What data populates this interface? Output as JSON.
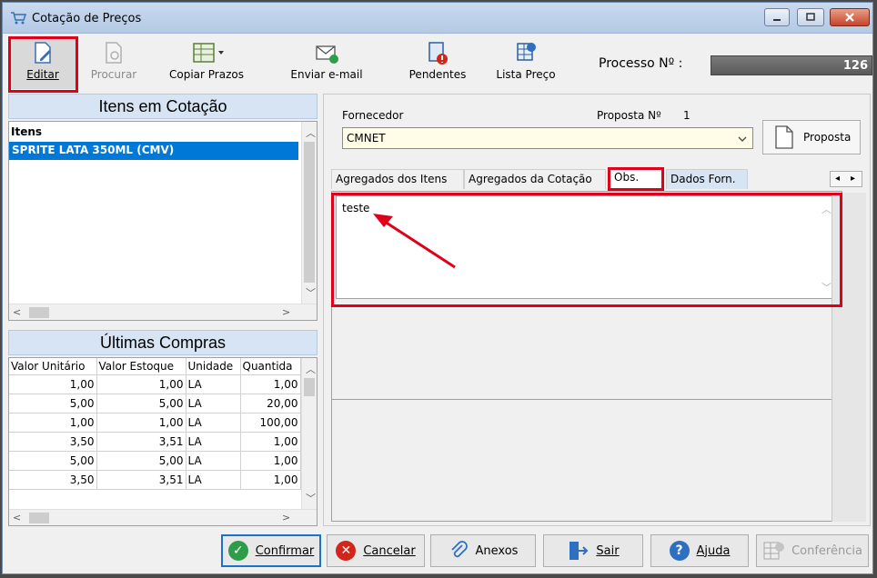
{
  "window": {
    "title": "Cotação de Preços"
  },
  "toolbar": {
    "editar": "Editar",
    "procurar": "Procurar",
    "copiar_prazos": "Copiar Prazos",
    "enviar_email": "Enviar e-mail",
    "pendentes": "Pendentes",
    "lista_preco": "Lista Preço",
    "processo_label": "Processo Nº :",
    "processo_value": "126"
  },
  "itens_panel": {
    "title": "Itens em Cotação",
    "column": "Itens",
    "items": [
      "SPRITE LATA 350ML (CMV)"
    ]
  },
  "compras_panel": {
    "title": "Últimas Compras",
    "columns": [
      "Valor Unitário",
      "Valor Estoque",
      "Unidade",
      "Quantida"
    ],
    "rows": [
      [
        "1,00",
        "1,00",
        "LA",
        "1,00"
      ],
      [
        "5,00",
        "5,00",
        "LA",
        "20,00"
      ],
      [
        "1,00",
        "1,00",
        "LA",
        "100,00"
      ],
      [
        "3,50",
        "3,51",
        "LA",
        "1,00"
      ],
      [
        "5,00",
        "5,00",
        "LA",
        "1,00"
      ],
      [
        "3,50",
        "3,51",
        "LA",
        "1,00"
      ]
    ]
  },
  "fornecedor": {
    "label": "Fornecedor",
    "value": "CMNET",
    "proposta_label": "Proposta Nº",
    "proposta_number": "1",
    "proposta_button": "Proposta"
  },
  "tabs": [
    "Agregados dos Itens",
    "Agregados da Cotação",
    "Obs.",
    "Dados Forn."
  ],
  "obs": {
    "text": "teste"
  },
  "bottom": {
    "confirmar": "Confirmar",
    "cancelar": "Cancelar",
    "anexos": "Anexos",
    "sair": "Sair",
    "ajuda": "Ajuda",
    "conferencia": "Conferência"
  },
  "colors": {
    "highlight": "#e0001a",
    "selection": "#0078d7",
    "combo_bg": "#fffde8"
  }
}
